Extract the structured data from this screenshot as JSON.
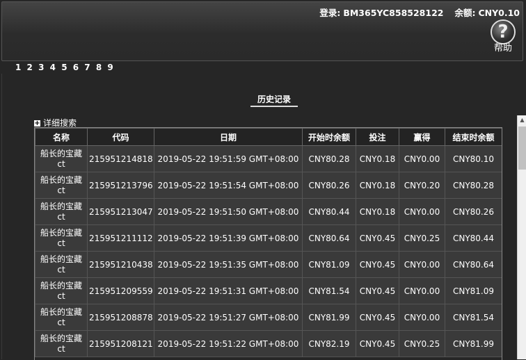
{
  "header": {
    "login_label": "登录:",
    "login_id": "BM365YC858528122",
    "balance_label": "余额:",
    "balance_value": "CNY0.10",
    "help_label": "帮助"
  },
  "pagination": [
    "1",
    "2",
    "3",
    "4",
    "5",
    "6",
    "7",
    "8",
    "9"
  ],
  "tab": {
    "label": "历史记录"
  },
  "search": {
    "label": "详细搜索"
  },
  "table": {
    "headers": [
      "名称",
      "代码",
      "日期",
      "开始时余额",
      "投注",
      "赢得",
      "结束时余额"
    ],
    "rows": [
      [
        "船长的宝藏ct",
        "215951214818",
        "2019-05-22 19:51:59 GMT+08:00",
        "CNY80.28",
        "CNY0.18",
        "CNY0.00",
        "CNY80.10"
      ],
      [
        "船长的宝藏ct",
        "215951213796",
        "2019-05-22 19:51:54 GMT+08:00",
        "CNY80.26",
        "CNY0.18",
        "CNY0.20",
        "CNY80.28"
      ],
      [
        "船长的宝藏ct",
        "215951213047",
        "2019-05-22 19:51:50 GMT+08:00",
        "CNY80.44",
        "CNY0.18",
        "CNY0.00",
        "CNY80.26"
      ],
      [
        "船长的宝藏ct",
        "215951211112",
        "2019-05-22 19:51:39 GMT+08:00",
        "CNY80.64",
        "CNY0.45",
        "CNY0.25",
        "CNY80.44"
      ],
      [
        "船长的宝藏ct",
        "215951210438",
        "2019-05-22 19:51:35 GMT+08:00",
        "CNY81.09",
        "CNY0.45",
        "CNY0.00",
        "CNY80.64"
      ],
      [
        "船长的宝藏ct",
        "215951209559",
        "2019-05-22 19:51:31 GMT+08:00",
        "CNY81.54",
        "CNY0.45",
        "CNY0.00",
        "CNY81.09"
      ],
      [
        "船长的宝藏ct",
        "215951208878",
        "2019-05-22 19:51:27 GMT+08:00",
        "CNY81.99",
        "CNY0.45",
        "CNY0.00",
        "CNY81.54"
      ],
      [
        "船长的宝藏ct",
        "215951208121",
        "2019-05-22 19:51:22 GMT+08:00",
        "CNY82.19",
        "CNY0.45",
        "CNY0.25",
        "CNY81.99"
      ]
    ]
  },
  "icons": {
    "help": "help-question-icon",
    "expand": "plus-icon",
    "scroll_up": "chevron-up-icon"
  }
}
